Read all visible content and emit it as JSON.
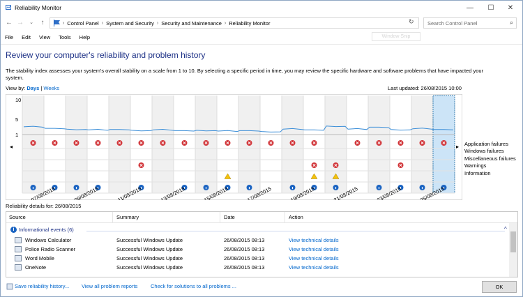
{
  "window": {
    "title": "Reliability Monitor"
  },
  "nav": {
    "breadcrumbs": [
      "Control Panel",
      "System and Security",
      "Security and Maintenance",
      "Reliability Monitor"
    ],
    "search_placeholder": "Search Control Panel"
  },
  "menu": [
    "File",
    "Edit",
    "View",
    "Tools",
    "Help"
  ],
  "ghost_label": "Window Snip",
  "heading": "Review your computer's reliability and problem history",
  "description": "The stability index assesses your system's overall stability on a scale from 1 to 10. By selecting a specific period in time, you may review the specific hardware and software problems that have impacted your system.",
  "viewby": {
    "label": "View by:",
    "days": "Days",
    "sep": "|",
    "weeks": "Weeks"
  },
  "last_updated": "Last updated: 26/08/2015 10:00",
  "chart_data": {
    "type": "line",
    "y_ticks": [
      "10",
      "5",
      "1"
    ],
    "x_tick_labels": [
      "07/08/2015",
      "09/08/2015",
      "11/08/2015",
      "13/08/2015",
      "15/08/2015",
      "17/08/2015",
      "19/08/2015",
      "21/08/2015",
      "23/08/2015",
      "25/08/2015"
    ],
    "legend": [
      "Application failures",
      "Windows failures",
      "Miscellaneous failures",
      "Warnings",
      "Information"
    ],
    "columns": 20,
    "selected_column": 19,
    "stability": [
      3.0,
      2.6,
      2.4,
      2.2,
      2.3,
      2.1,
      2.2,
      2.0,
      2.1,
      1.9,
      2.0,
      1.8,
      2.4,
      2.2,
      3.2,
      2.4,
      2.9,
      2.3,
      2.5,
      2.3
    ],
    "app_failures": [
      1,
      1,
      1,
      1,
      1,
      1,
      1,
      1,
      1,
      1,
      1,
      1,
      1,
      1,
      0,
      1,
      1,
      1,
      1,
      1
    ],
    "misc_failures": [
      0,
      0,
      0,
      0,
      0,
      1,
      0,
      0,
      0,
      0,
      0,
      0,
      0,
      1,
      1,
      0,
      0,
      1,
      0,
      0
    ],
    "warnings": [
      0,
      0,
      0,
      0,
      0,
      0,
      0,
      0,
      0,
      1,
      0,
      0,
      0,
      1,
      1,
      0,
      0,
      0,
      0,
      0
    ],
    "information": [
      1,
      1,
      1,
      1,
      0,
      1,
      0,
      1,
      1,
      1,
      1,
      0,
      1,
      1,
      1,
      0,
      1,
      1,
      1,
      1
    ]
  },
  "details_label": "Reliability details for: 26/08/2015",
  "table": {
    "columns": [
      "Source",
      "Summary",
      "Date",
      "Action"
    ],
    "group": "Informational events (6)",
    "rows": [
      {
        "source": "Windows Calculator",
        "summary": "Successful Windows Update",
        "date": "26/08/2015 08:13",
        "action": "View technical details"
      },
      {
        "source": "Police Radio Scanner",
        "summary": "Successful Windows Update",
        "date": "26/08/2015 08:13",
        "action": "View technical details"
      },
      {
        "source": "Word Mobile",
        "summary": "Successful Windows Update",
        "date": "26/08/2015 08:13",
        "action": "View technical details"
      },
      {
        "source": "OneNote",
        "summary": "Successful Windows Update",
        "date": "26/08/2015 08:13",
        "action": "View technical details"
      }
    ]
  },
  "footer": {
    "save": "Save reliability history...",
    "view_all": "View all problem reports",
    "check": "Check for solutions to all problems ...",
    "ok": "OK"
  },
  "colors": {
    "accent": "#1e3287",
    "link": "#0066cc",
    "line": "#3b8ed8",
    "selection": "#cce4f7"
  }
}
